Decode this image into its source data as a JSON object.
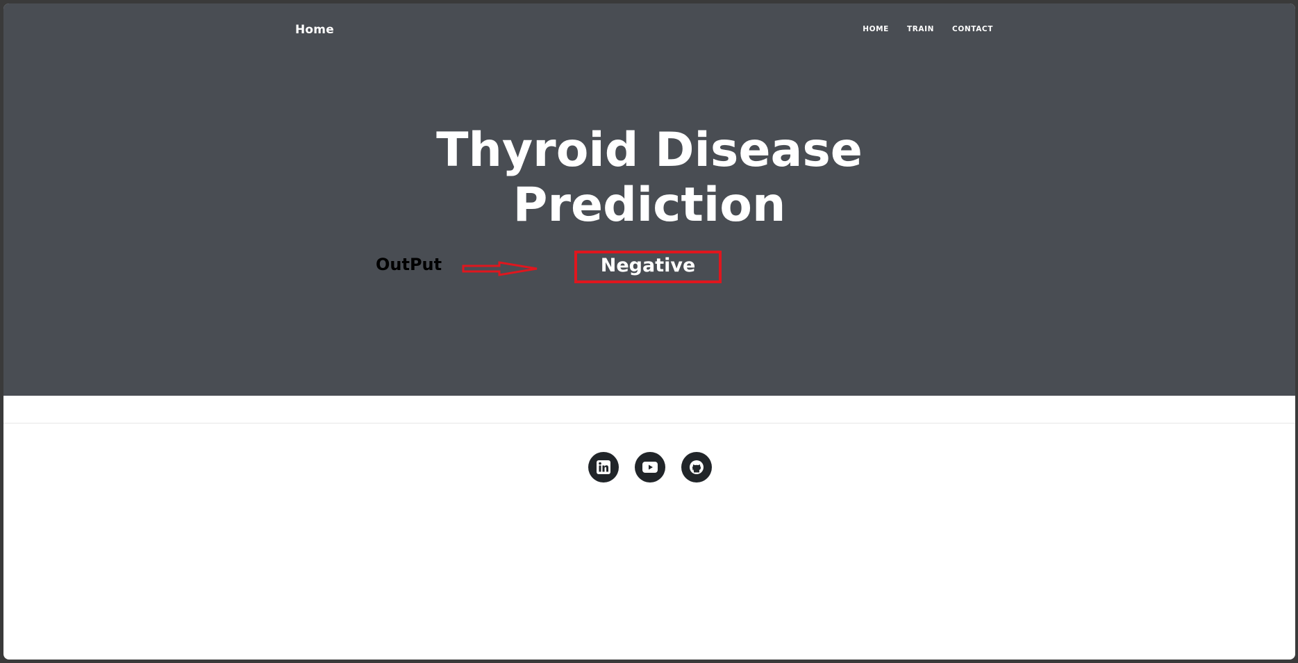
{
  "nav": {
    "brand": "Home",
    "links": [
      "HOME",
      "TRAIN",
      "CONTACT"
    ]
  },
  "hero": {
    "title_line1": "Thyroid Disease",
    "title_line2": "Prediction",
    "output_label": "OutPut",
    "result": "Negative"
  },
  "footer": {
    "social_icons": [
      "linkedin-icon",
      "youtube-icon",
      "github-icon"
    ]
  },
  "colors": {
    "hero_background": "#494d53",
    "highlight_red": "#e0161e",
    "social_circle": "#212529"
  }
}
